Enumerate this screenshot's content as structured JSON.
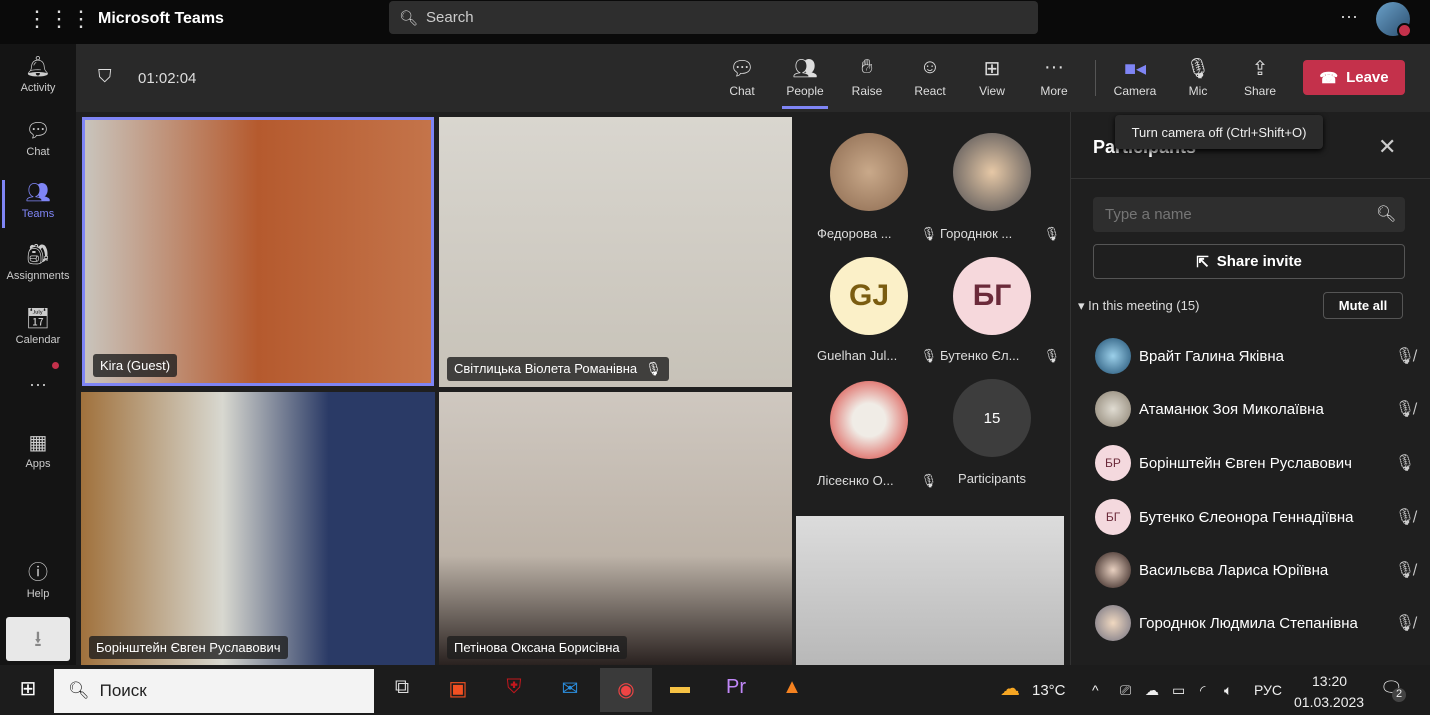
{
  "app": {
    "title": "Microsoft Teams",
    "search_placeholder": "Search"
  },
  "rail": [
    {
      "label": "Activity",
      "icon": "bell-icon"
    },
    {
      "label": "Chat",
      "icon": "chat-icon"
    },
    {
      "label": "Teams",
      "icon": "teams-icon",
      "active": true
    },
    {
      "label": "Assignments",
      "icon": "assignments-icon"
    },
    {
      "label": "Calendar",
      "icon": "calendar-icon"
    },
    {
      "label": "Apps",
      "icon": "apps-icon"
    },
    {
      "label": "Help",
      "icon": "help-icon"
    }
  ],
  "meeting": {
    "timer": "01:02:04",
    "controls": [
      "Chat",
      "People",
      "Raise",
      "React",
      "View",
      "More",
      "Camera",
      "Mic",
      "Share"
    ],
    "leave": "Leave",
    "tooltip": "Turn camera off (Ctrl+Shift+O)"
  },
  "videos": [
    "Kira (Guest)",
    "Світлицька Віолета Романівна",
    "Борінштейн Євген Руславович",
    "Петінова Оксана Борисівна"
  ],
  "gallery": [
    {
      "name": "Федорова ...",
      "muted": true
    },
    {
      "name": "Городнюк ...",
      "muted": true
    },
    {
      "name": "Guelhan Jul...",
      "initials": "GJ",
      "muted": true
    },
    {
      "name": "Бутенко Єл...",
      "initials": "БГ",
      "muted": true
    },
    {
      "name": "Лісеєнко О...",
      "muted": true
    },
    {
      "name": "Participants",
      "count": "15"
    }
  ],
  "panel": {
    "title": "Participants",
    "search_placeholder": "Type a name",
    "share_invite": "Share invite",
    "in_meeting": "In this meeting (15)",
    "mute_all": "Mute all",
    "people": [
      {
        "name": "Врайт Галина Яківна",
        "muted": true
      },
      {
        "name": "Атаманюк Зоя Миколаївна",
        "muted": true
      },
      {
        "name": "Борінштейн Євген Руславович",
        "initials": "БР",
        "muted": false
      },
      {
        "name": "Бутенко Єлеонора Геннадіївна",
        "initials": "БГ",
        "muted": true
      },
      {
        "name": "Васильєва Лариса Юріївна",
        "muted": true
      },
      {
        "name": "Городнюк Людмила Степанівна",
        "muted": true
      }
    ]
  },
  "taskbar": {
    "search": "Поиск",
    "weather": "13°C",
    "lang": "РУС",
    "time": "13:20",
    "date": "01.03.2023",
    "notifications": "2"
  },
  "colors": {
    "accent": "#7f85f5",
    "leave": "#c4314b"
  }
}
